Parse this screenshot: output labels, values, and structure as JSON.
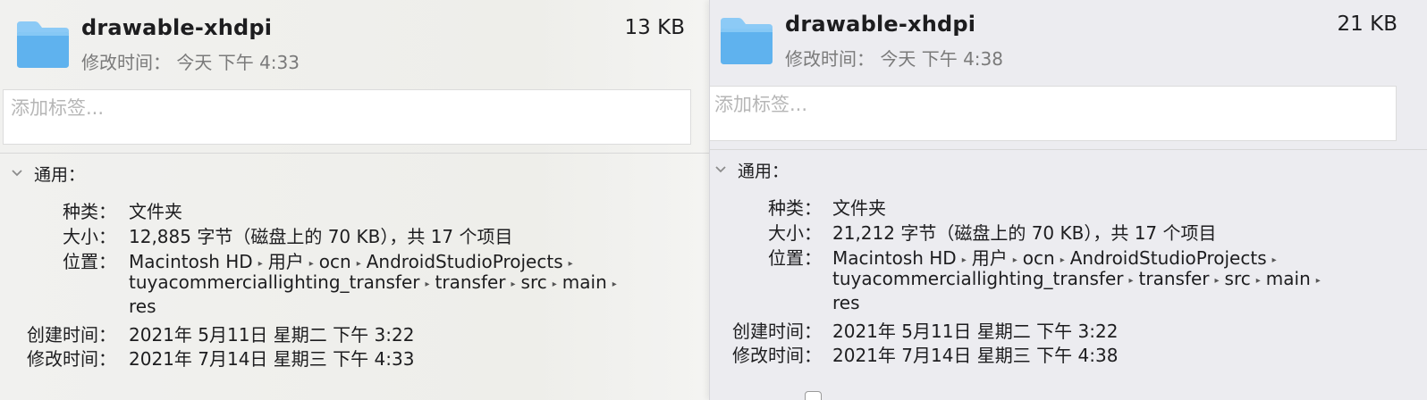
{
  "panels": [
    {
      "name": "drawable-xhdpi",
      "size": "13 KB",
      "modified_label": "修改时间：",
      "modified_value": "今天 下午 4:33",
      "tags_placeholder": "添加标签...",
      "section_general": "通用：",
      "kind_label": "种类：",
      "kind_value": "文件夹",
      "size_label": "大小：",
      "size_value": "12,885 字节（磁盘上的 70 KB），共 17 个项目",
      "where_label": "位置：",
      "path": [
        "Macintosh HD",
        "用户",
        "ocn",
        "AndroidStudioProjects",
        "tuyacommerciallighting_transfer",
        "transfer",
        "src",
        "main",
        "res"
      ],
      "created_label": "创建时间：",
      "created_value": "2021年 5月11日 星期二 下午 3:22",
      "modified2_label": "修改时间：",
      "modified2_value": "2021年 7月14日 星期三 下午 4:33"
    },
    {
      "name": "drawable-xhdpi",
      "size": "21 KB",
      "modified_label": "修改时间：",
      "modified_value": "今天 下午 4:38",
      "tags_placeholder": "添加标签...",
      "section_general": "通用：",
      "kind_label": "种类：",
      "kind_value": "文件夹",
      "size_label": "大小：",
      "size_value": "21,212 字节（磁盘上的 70 KB），共 17 个项目",
      "where_label": "位置：",
      "path": [
        "Macintosh HD",
        "用户",
        "ocn",
        "AndroidStudioProjects",
        "tuyacommerciallighting_transfer",
        "transfer",
        "src",
        "main",
        "res"
      ],
      "created_label": "创建时间：",
      "created_value": "2021年 5月11日 星期二 下午 3:22",
      "modified2_label": "修改时间：",
      "modified2_value": "2021年 7月14日 星期三 下午 4:38"
    }
  ],
  "icons": {
    "folder": "folder-icon",
    "disclosure": "chevron-down-icon",
    "path_separator": "▸"
  },
  "colors": {
    "folder_front": "#5fb2ee",
    "folder_back": "#8ccaf6"
  }
}
